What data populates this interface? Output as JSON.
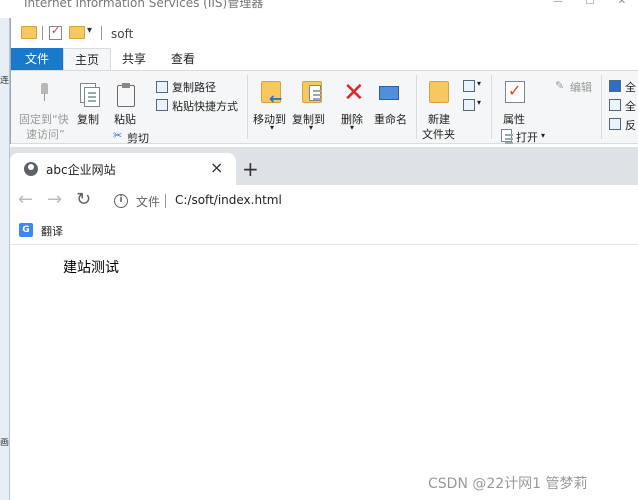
{
  "iis": {
    "title": "Internet Information Services (IIS)管理器",
    "controls": [
      "—",
      "☐",
      "✕"
    ],
    "left_fragments": [
      "连",
      "",
      "画"
    ]
  },
  "explorer": {
    "quick_access_dropdown": "▾",
    "title": "soft",
    "tabs": {
      "file": "文件",
      "home": "主页",
      "share": "共享",
      "view": "查看"
    },
    "ribbon": {
      "pin_line1": "固定到“快",
      "pin_line2": "速访问”",
      "copy": "复制",
      "paste": "粘贴",
      "copy_path": "复制路径",
      "paste_shortcut": "粘贴快捷方式",
      "cut": "剪切",
      "move_to": "移动到",
      "copy_to": "复制到",
      "delete": "删除",
      "rename": "重命名",
      "new_folder_line1": "新建",
      "new_folder_line2": "文件夹",
      "properties": "属性",
      "open": "打开",
      "edit": "编辑",
      "select_all": "全",
      "select_none": "全",
      "invert": "反"
    }
  },
  "browser": {
    "tab_title": "abc企业网站",
    "tab_close": "×",
    "new_tab": "+",
    "nav": {
      "back": "←",
      "forward": "→",
      "reload": "↻"
    },
    "scheme_label": "文件",
    "url": "C:/soft/index.html",
    "bookmark_translate": "翻译",
    "page_text": "建站测试"
  },
  "watermark": "CSDN @22计网1  管梦莉"
}
